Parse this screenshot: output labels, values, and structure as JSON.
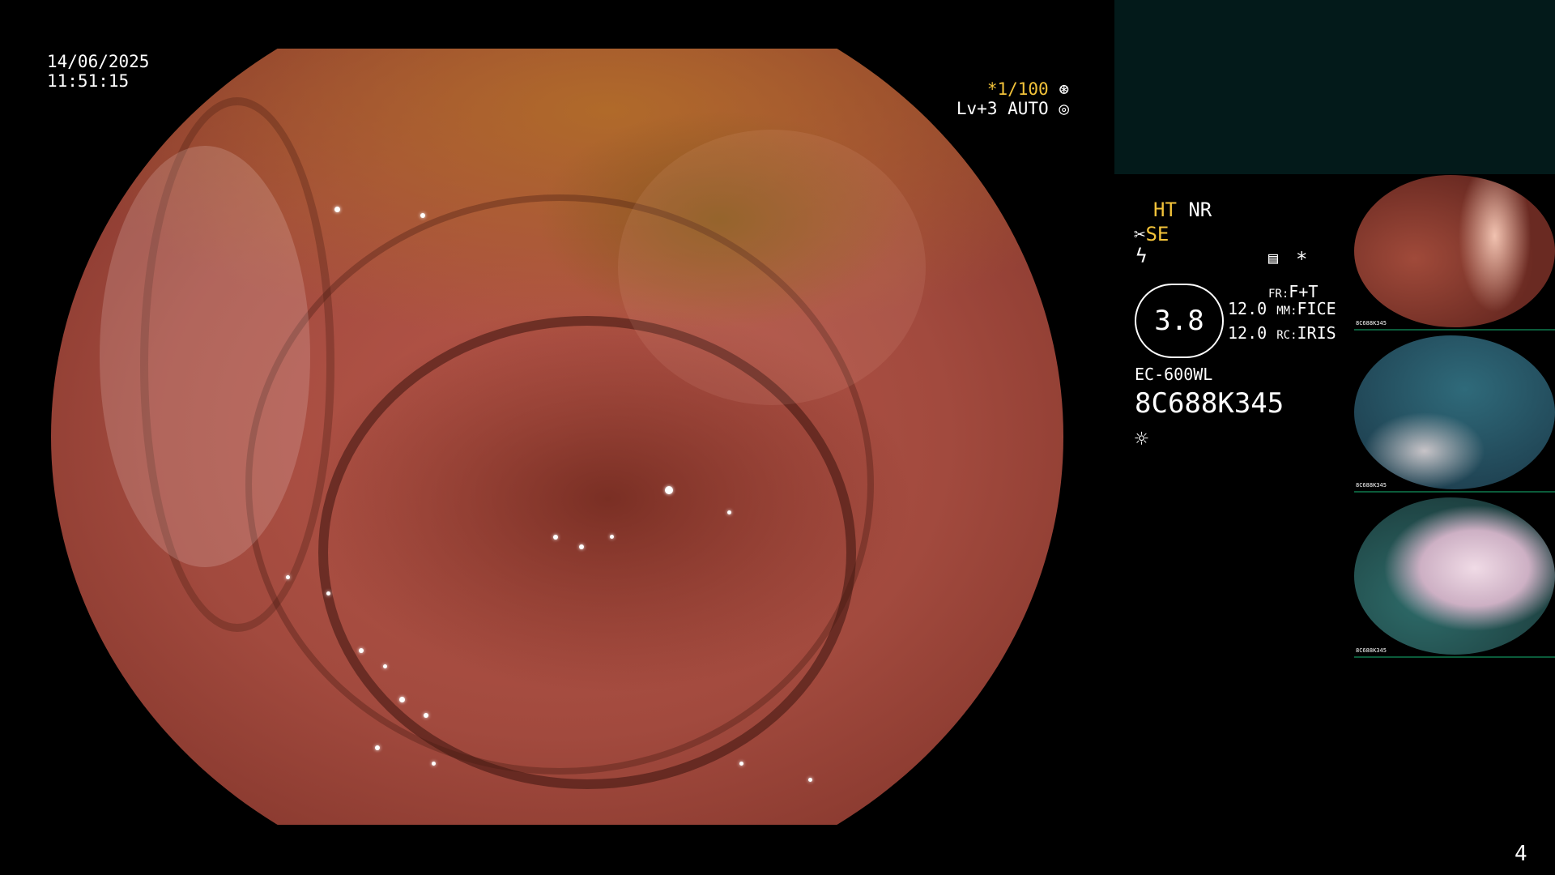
{
  "datetime": {
    "date": "14/06/2025",
    "time": "11:51:15"
  },
  "scope_status": {
    "shutter": "*1/100",
    "level": "Lv+3 AUTO"
  },
  "panel": {
    "ht": "HT",
    "nr": "NR",
    "se": "SE",
    "gauge_value": "3.8",
    "fr_label": "FR:",
    "fr_value": "F+T",
    "mm_value_left": "12.0",
    "mm_label": "MM:",
    "mm_value": "FICE",
    "rc_value_left": "12.0",
    "rc_label": "RC:",
    "rc_value": "IRIS",
    "scope_model": "EC-600WL",
    "serial": "8C688K345",
    "star": "*"
  },
  "thumbnails": [
    {
      "id": "1",
      "label": "8C688K345"
    },
    {
      "id": "2",
      "label": "8C688K345"
    },
    {
      "id": "3",
      "label": "8C688K345"
    }
  ],
  "page_number": "4",
  "icons": [
    "shutter-icon",
    "auto-iris-icon",
    "scissors-icon",
    "lightning-icon",
    "memory-icon",
    "gauge-icon",
    "sun-icon"
  ],
  "colors": {
    "status_accent": "#f3c33a",
    "side_header": "#031a1a"
  }
}
